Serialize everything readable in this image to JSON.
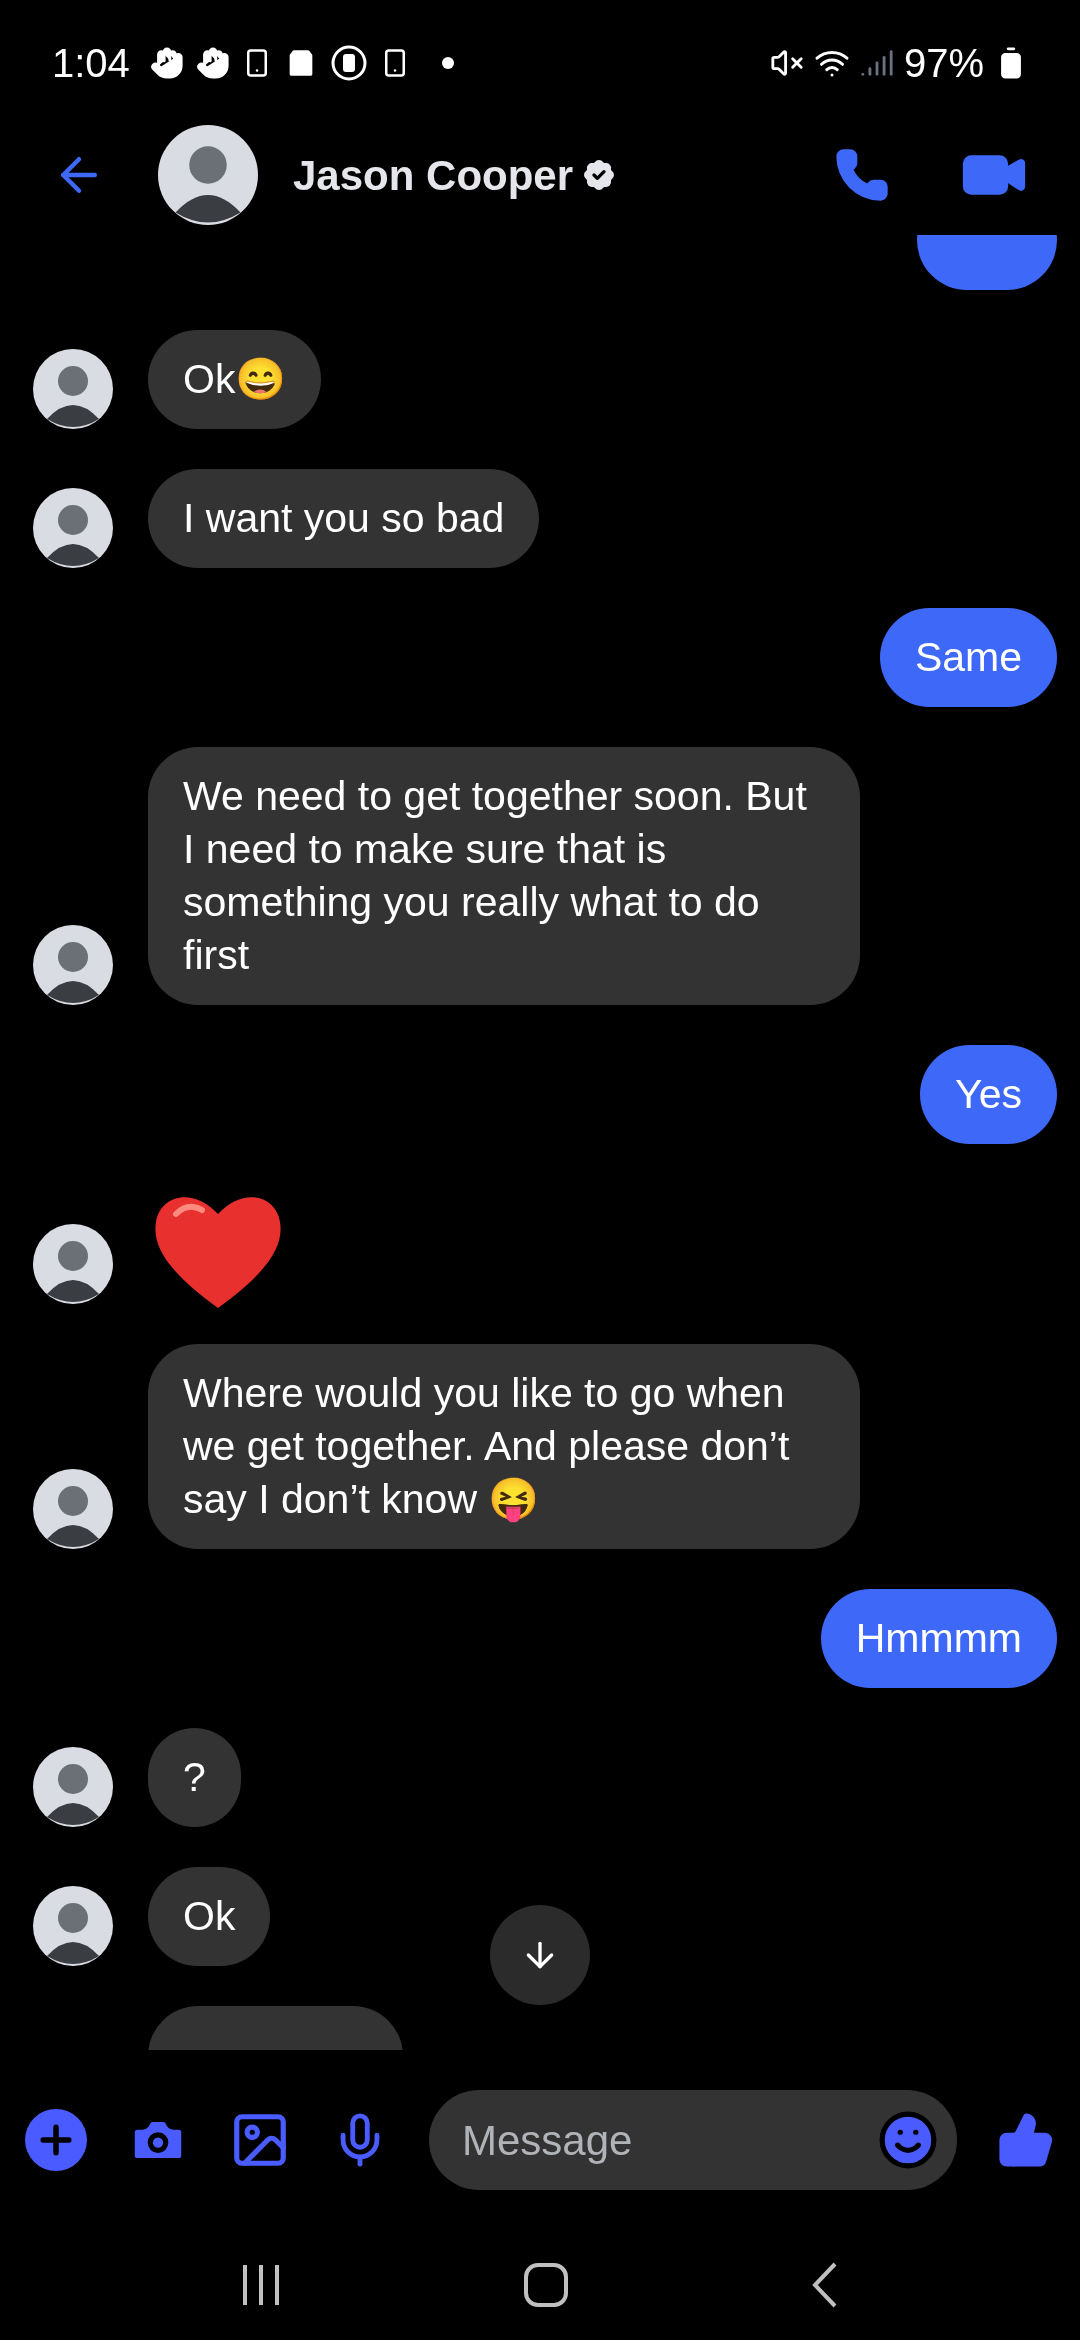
{
  "status_bar": {
    "time": "1:04",
    "battery": "97%"
  },
  "header": {
    "name": "Jason Cooper",
    "verified": true
  },
  "messages": [
    {
      "kind": "fragment",
      "outgoing": true
    },
    {
      "kind": "text",
      "outgoing": false,
      "text": "Ok😄"
    },
    {
      "kind": "text",
      "outgoing": false,
      "text": "I want you so bad"
    },
    {
      "kind": "text",
      "outgoing": true,
      "text": "Same"
    },
    {
      "kind": "text",
      "outgoing": false,
      "text": "We need to get together soon. But I need to make sure that is something you really what to do first"
    },
    {
      "kind": "text",
      "outgoing": true,
      "text": "Yes"
    },
    {
      "kind": "heart",
      "outgoing": false
    },
    {
      "kind": "text",
      "outgoing": false,
      "text": "Where would you like to go when we get together. And please don’t say I don’t know 😝"
    },
    {
      "kind": "text",
      "outgoing": true,
      "text": "Hmmmm"
    },
    {
      "kind": "text",
      "outgoing": false,
      "text": "?"
    },
    {
      "kind": "text",
      "outgoing": false,
      "text": "Ok"
    },
    {
      "kind": "fragment",
      "outgoing": false
    }
  ],
  "composer": {
    "placeholder": "Message"
  }
}
